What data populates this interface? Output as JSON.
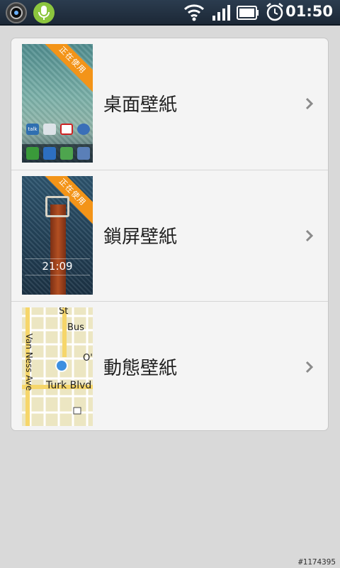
{
  "status_bar": {
    "time": "01:50",
    "icons": [
      "camera-app-icon",
      "microphone-icon",
      "wifi-icon",
      "signal-icon",
      "battery-icon",
      "alarm-icon"
    ]
  },
  "wallpaper_menu": {
    "items": [
      {
        "label": "桌面壁紙",
        "badge": "正在使用"
      },
      {
        "label": "鎖屏壁紙",
        "badge": "正在使用",
        "lock_time": "21:09"
      },
      {
        "label": "動態壁紙",
        "map_labels": [
          "St",
          "Bus",
          "O'",
          "Van Ness Ave",
          "Turk Blvd"
        ]
      }
    ]
  },
  "home_thumb": {
    "app_labels": [
      "talk"
    ]
  },
  "watermark": "#1174395"
}
